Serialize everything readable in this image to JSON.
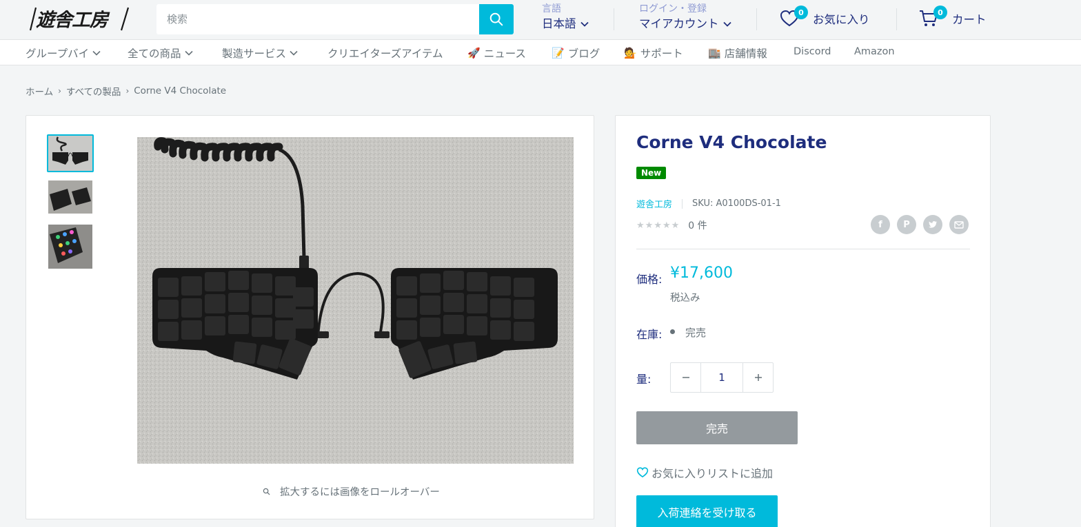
{
  "header": {
    "logo_text": "遊舎工房",
    "search": {
      "placeholder": "検索"
    },
    "language": {
      "small": "言語",
      "value": "日本語"
    },
    "account": {
      "small": "ログイン・登録",
      "value": "マイアカウント"
    },
    "wishlist": {
      "count": "0",
      "label": "お気に入り"
    },
    "cart": {
      "count": "0",
      "label": "カート"
    }
  },
  "nav": {
    "items": [
      {
        "label": "グループバイ",
        "icon": "",
        "dropdown": true
      },
      {
        "label": "全ての商品",
        "icon": "",
        "dropdown": true
      },
      {
        "label": "製造サービス",
        "icon": "",
        "dropdown": true
      },
      {
        "label": "クリエイターズアイテム",
        "icon": "",
        "dropdown": false
      },
      {
        "label": "ニュース",
        "icon": "🚀",
        "dropdown": false
      },
      {
        "label": "ブログ",
        "icon": "📝",
        "dropdown": false
      },
      {
        "label": "サポート",
        "icon": "💁",
        "dropdown": false
      },
      {
        "label": "店舗情報",
        "icon": "🏬",
        "dropdown": false
      },
      {
        "label": "Discord",
        "icon": "",
        "dropdown": false
      },
      {
        "label": "Amazon",
        "icon": "",
        "dropdown": false
      }
    ]
  },
  "breadcrumb": {
    "home": "ホーム",
    "collection": "すべての製品",
    "current": "Corne V4 Chocolate"
  },
  "gallery": {
    "zoom_hint": "拡大するには画像をロールオーバー"
  },
  "product": {
    "title": "Corne V4 Chocolate",
    "badge": "New",
    "vendor": "遊舎工房",
    "sku": "SKU: A0100DS-01-1",
    "rating_count": "0 件",
    "share_icons": [
      "facebook-icon",
      "pinterest-icon",
      "twitter-icon",
      "email-icon"
    ],
    "price_label": "価格:",
    "price": "¥17,600",
    "tax_note": "税込み",
    "stock_label": "在庫:",
    "stock_value": "完売",
    "qty_label": "量:",
    "qty_value": "1",
    "soldout_button": "完売",
    "wishlist_link": "お気に入りリストに追加",
    "notify_button": "入荷連絡を受け取る"
  },
  "colors": {
    "accent": "#00badb",
    "heading": "#1e2d7d",
    "text": "#677279",
    "new_badge": "#008a00",
    "soldout": "#949a9e"
  }
}
